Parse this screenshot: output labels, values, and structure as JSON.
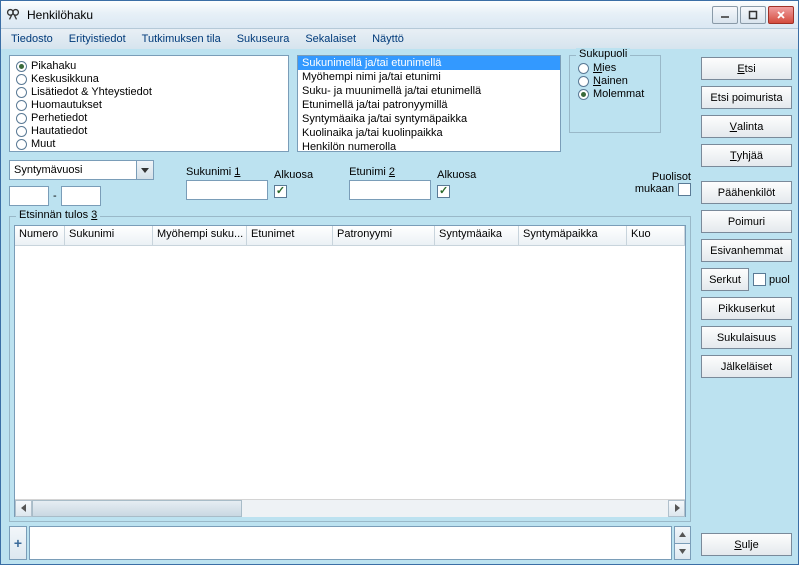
{
  "window": {
    "title": "Henkilöhaku"
  },
  "menu": {
    "tiedosto": "Tiedosto",
    "erityistiedot": "Erityistiedot",
    "tutkimuksen_tila": "Tutkimuksen tila",
    "sukuseura": "Sukuseura",
    "sekalaiset": "Sekalaiset",
    "naytto": "Näyttö"
  },
  "search_type": {
    "pikahaku": "Pikahaku",
    "keskusikkuna": "Keskusikkuna",
    "lisatiedot": "Lisätiedot & Yhteystiedot",
    "huomautukset": "Huomautukset",
    "perhetiedot": "Perhetiedot",
    "hautatiedot": "Hautatiedot",
    "muut": "Muut"
  },
  "criteria_list": [
    "Sukunimellä ja/tai etunimellä",
    "Myöhempi nimi ja/tai etunimi",
    "Suku- ja muunimellä ja/tai etunimellä",
    "Etunimellä ja/tai patronyymillä",
    "Syntymäaika ja/tai syntymäpaikka",
    "Kuolinaika ja/tai kuolinpaikka",
    "Henkilön numerolla"
  ],
  "gender": {
    "legend": "Sukupuoli",
    "mies": "Mies",
    "nainen": "Nainen",
    "molemmat": "Molemmat"
  },
  "combo": {
    "value": "Syntymävuosi"
  },
  "fields": {
    "sukunimi_label_pre": "Sukunimi ",
    "sukunimi_key": "1",
    "etunimi_label_pre": "Etunimi ",
    "etunimi_key": "2",
    "alkuosa": "Alkuosa"
  },
  "puolisot": {
    "line1": "Puolisot",
    "line2": "mukaan"
  },
  "results": {
    "legend_pre": "Etsinnän tulos ",
    "legend_key": "3",
    "cols": {
      "numero": "Numero",
      "sukunimi": "Sukunimi",
      "myohempi": "Myöhempi suku...",
      "etunimet": "Etunimet",
      "patronyymi": "Patronyymi",
      "syntymaaika": "Syntymäaika",
      "syntymapaikka": "Syntymäpaikka",
      "kuo": "Kuo"
    }
  },
  "buttons": {
    "etsi": "Etsi",
    "etsi_poimurista": "Etsi poimurista",
    "valinta": "Valinta",
    "tyhjaa": "Tyhjää",
    "paahenkilot": "Päähenkilöt",
    "poimuri": "Poimuri",
    "esivanhemmat": "Esivanhemmat",
    "serkut": "Serkut",
    "puol": "puol",
    "pikkuserkut": "Pikkuserkut",
    "sukulaisuus": "Sukulaisuus",
    "jalkelaiset": "Jälkeläiset",
    "sulje": "Sulje"
  }
}
